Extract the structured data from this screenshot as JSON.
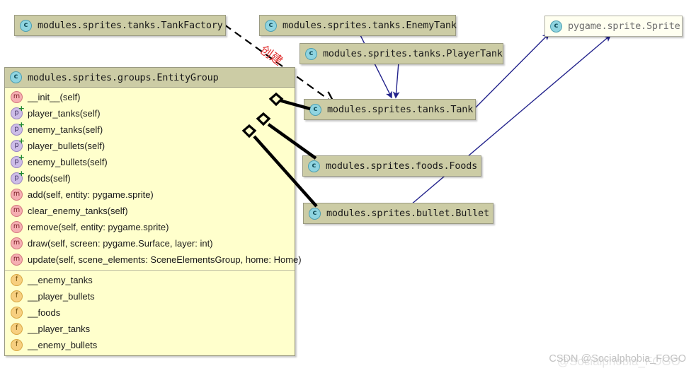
{
  "diagram": {
    "kind": "uml-class-diagram",
    "background": "#ffffff",
    "colors": {
      "header_fill": "#cccca5",
      "body_fill": "#ffffcc",
      "external_fill": "#fffff0",
      "border": "#9a9a82",
      "inheritance_arrow": "#23238c",
      "aggregation_line": "#000000",
      "dependency_label": "#e03030",
      "watermark": "#c2c2c2"
    }
  },
  "classes": {
    "tank_factory": {
      "icon": "class-icon",
      "title": "modules.sprites.tanks.TankFactory"
    },
    "enemy_tank": {
      "icon": "class-icon",
      "title": "modules.sprites.tanks.EnemyTank"
    },
    "player_tank": {
      "icon": "class-icon",
      "title": "modules.sprites.tanks.PlayerTank"
    },
    "pygame_sprite": {
      "icon": "class-icon",
      "title": "pygame.sprite.Sprite"
    },
    "tank": {
      "icon": "class-icon",
      "title": "modules.sprites.tanks.Tank"
    },
    "foods": {
      "icon": "class-icon",
      "title": "modules.sprites.foods.Foods"
    },
    "bullet": {
      "icon": "class-icon",
      "title": "modules.sprites.bullet.Bullet"
    },
    "entity_group": {
      "icon": "class-icon",
      "title": "modules.sprites.groups.EntityGroup",
      "members": [
        {
          "kind": "method",
          "icon": "method-icon",
          "glyph": "m",
          "label": "__init__(self)"
        },
        {
          "kind": "property",
          "icon": "property-icon",
          "glyph": "p",
          "label": "player_tanks(self)"
        },
        {
          "kind": "property",
          "icon": "property-icon",
          "glyph": "p",
          "label": "enemy_tanks(self)"
        },
        {
          "kind": "property",
          "icon": "property-icon",
          "glyph": "p",
          "label": "player_bullets(self)"
        },
        {
          "kind": "property",
          "icon": "property-icon",
          "glyph": "p",
          "label": "enemy_bullets(self)"
        },
        {
          "kind": "property",
          "icon": "property-icon",
          "glyph": "p",
          "label": "foods(self)"
        },
        {
          "kind": "method",
          "icon": "method-icon",
          "glyph": "m",
          "label": "add(self, entity: pygame.sprite)"
        },
        {
          "kind": "method",
          "icon": "method-icon",
          "glyph": "m",
          "label": "clear_enemy_tanks(self)"
        },
        {
          "kind": "method",
          "icon": "method-icon",
          "glyph": "m",
          "label": "remove(self, entity: pygame.sprite)"
        },
        {
          "kind": "method",
          "icon": "method-icon",
          "glyph": "m",
          "label": "draw(self, screen: pygame.Surface, layer: int)"
        },
        {
          "kind": "method",
          "icon": "method-icon",
          "glyph": "m",
          "label": "update(self, scene_elements: SceneElementsGroup, home: Home)"
        }
      ],
      "fields": [
        {
          "kind": "field",
          "icon": "field-icon",
          "glyph": "f",
          "label": "__enemy_tanks"
        },
        {
          "kind": "field",
          "icon": "field-icon",
          "glyph": "f",
          "label": "__player_bullets"
        },
        {
          "kind": "field",
          "icon": "field-icon",
          "glyph": "f",
          "label": "__foods"
        },
        {
          "kind": "field",
          "icon": "field-icon",
          "glyph": "f",
          "label": "__player_tanks"
        },
        {
          "kind": "field",
          "icon": "field-icon",
          "glyph": "f",
          "label": "__enemy_bullets"
        }
      ]
    }
  },
  "relationships": [
    {
      "type": "dependency",
      "from": "tank_factory",
      "to": "tank",
      "label": "创建",
      "style": "dashed",
      "color": "#000000"
    },
    {
      "type": "inheritance",
      "from": "enemy_tank",
      "to": "tank",
      "label": "",
      "style": "solid",
      "color": "#23238c"
    },
    {
      "type": "inheritance",
      "from": "player_tank",
      "to": "tank",
      "label": "",
      "style": "solid",
      "color": "#23238c"
    },
    {
      "type": "inheritance",
      "from": "tank",
      "to": "pygame_sprite",
      "label": "",
      "style": "solid",
      "color": "#23238c"
    },
    {
      "type": "inheritance",
      "from": "bullet",
      "to": "pygame_sprite",
      "label": "",
      "style": "solid",
      "color": "#23238c"
    },
    {
      "type": "aggregation",
      "from": "entity_group",
      "to": "tank",
      "label": "",
      "style": "solid",
      "color": "#000000"
    },
    {
      "type": "aggregation",
      "from": "entity_group",
      "to": "foods",
      "label": "",
      "style": "solid",
      "color": "#000000"
    },
    {
      "type": "aggregation",
      "from": "entity_group",
      "to": "bullet",
      "label": "",
      "style": "solid",
      "color": "#000000"
    }
  ],
  "watermark": {
    "text": "CSDN @Socialphobia_FOGO",
    "ghost_text": "@Socialphobia_FOGO"
  }
}
